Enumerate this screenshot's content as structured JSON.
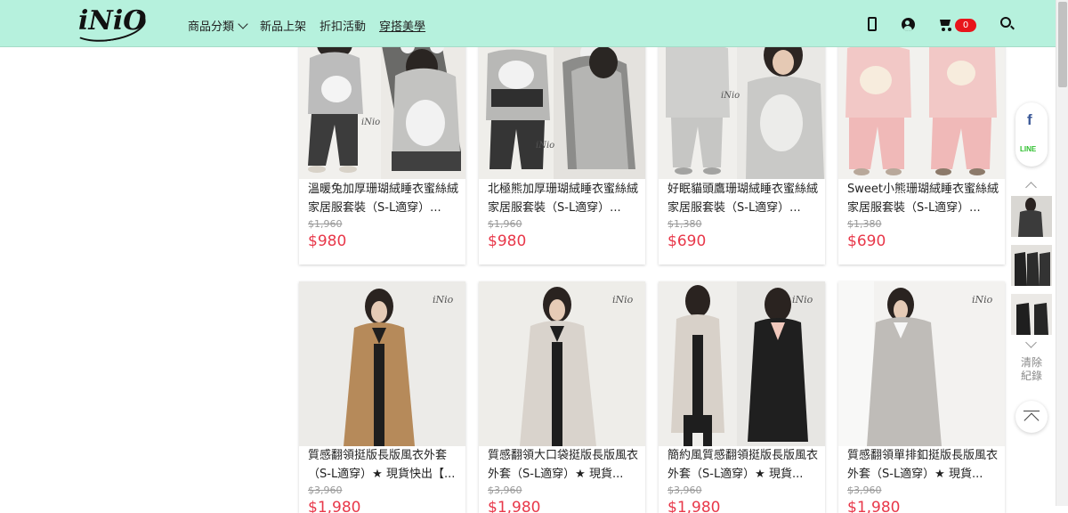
{
  "header": {
    "logo_text": "iNiO",
    "nav": [
      {
        "label": "商品分類",
        "has_dropdown": true,
        "active": false
      },
      {
        "label": "新品上架",
        "has_dropdown": false,
        "active": false
      },
      {
        "label": "折扣活動",
        "has_dropdown": false,
        "active": false
      },
      {
        "label": "穿搭美學",
        "has_dropdown": false,
        "active": true
      }
    ],
    "icons": [
      "phone-icon",
      "user-icon",
      "cart-icon",
      "search-icon"
    ],
    "cart_count": "0",
    "background": "#b6f1dd",
    "badge_color": "#e8151b"
  },
  "products": [
    {
      "name": "溫暖兔加厚珊瑚絨睡衣蜜絲絨家居服套裝（S-L適穿）...",
      "old_price": "$1,960",
      "price": "$980"
    },
    {
      "name": "北極熊加厚珊瑚絨睡衣蜜絲絨家居服套裝（S-L適穿）...",
      "old_price": "$1,960",
      "price": "$980"
    },
    {
      "name": "好眠貓頭鷹珊瑚絨睡衣蜜絲絨家居服套裝（S-L適穿）...",
      "old_price": "$1,380",
      "price": "$690"
    },
    {
      "name": "Sweet小熊珊瑚絨睡衣蜜絲絨家居服套裝（S-L適穿）...",
      "old_price": "$1,380",
      "price": "$690"
    },
    {
      "name": "質感翻領挺版長版風衣外套（S-L適穿）★ 現貨快出【...",
      "old_price": "$3,960",
      "price": "$1,980"
    },
    {
      "name": "質感翻領大口袋挺版長版風衣外套（S-L適穿）★ 現貨...",
      "old_price": "$3,960",
      "price": "$1,980"
    },
    {
      "name": "簡約風質感翻領挺版長版風衣外套（S-L適穿）★ 現貨...",
      "old_price": "$3,960",
      "price": "$1,980"
    },
    {
      "name": "質感翻領單排釦挺版長版風衣外套（S-L適穿）★ 現貨...",
      "old_price": "$3,960",
      "price": "$1,980"
    }
  ],
  "sidebar": {
    "share": [
      "facebook-icon",
      "line-icon"
    ],
    "facebook_label": "f",
    "line_label": "LINE",
    "clear_label": "清除紀錄"
  },
  "colors": {
    "price": "#e8384a",
    "old_price": "#999999"
  }
}
